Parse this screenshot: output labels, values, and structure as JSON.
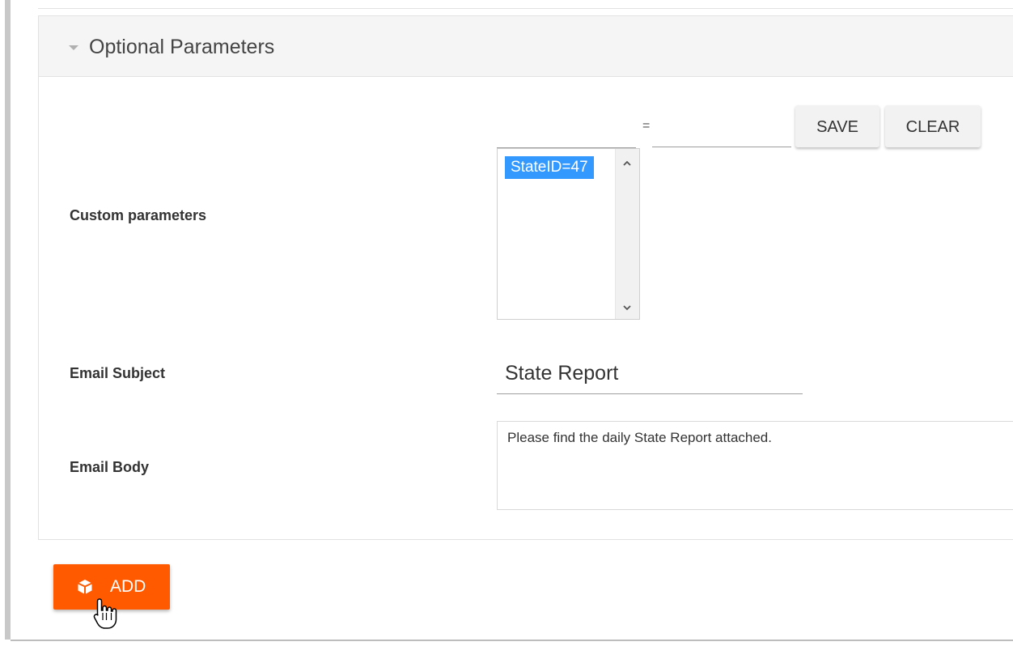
{
  "panel": {
    "title": "Optional Parameters"
  },
  "custom_parameters": {
    "label": "Custom parameters",
    "equals_sign": "=",
    "value_input": "",
    "save_label": "SAVE",
    "clear_label": "CLEAR",
    "list_items": [
      "StateID=47"
    ]
  },
  "email_subject": {
    "label": "Email Subject",
    "value": "State Report"
  },
  "email_body": {
    "label": "Email Body",
    "value": "Please find the daily State Report attached."
  },
  "add_button": {
    "label": "ADD",
    "icon": "cube-icon",
    "color": "#ff5a00"
  },
  "colors": {
    "selection": "#3399ff",
    "header_bg": "#f5f5f5"
  }
}
